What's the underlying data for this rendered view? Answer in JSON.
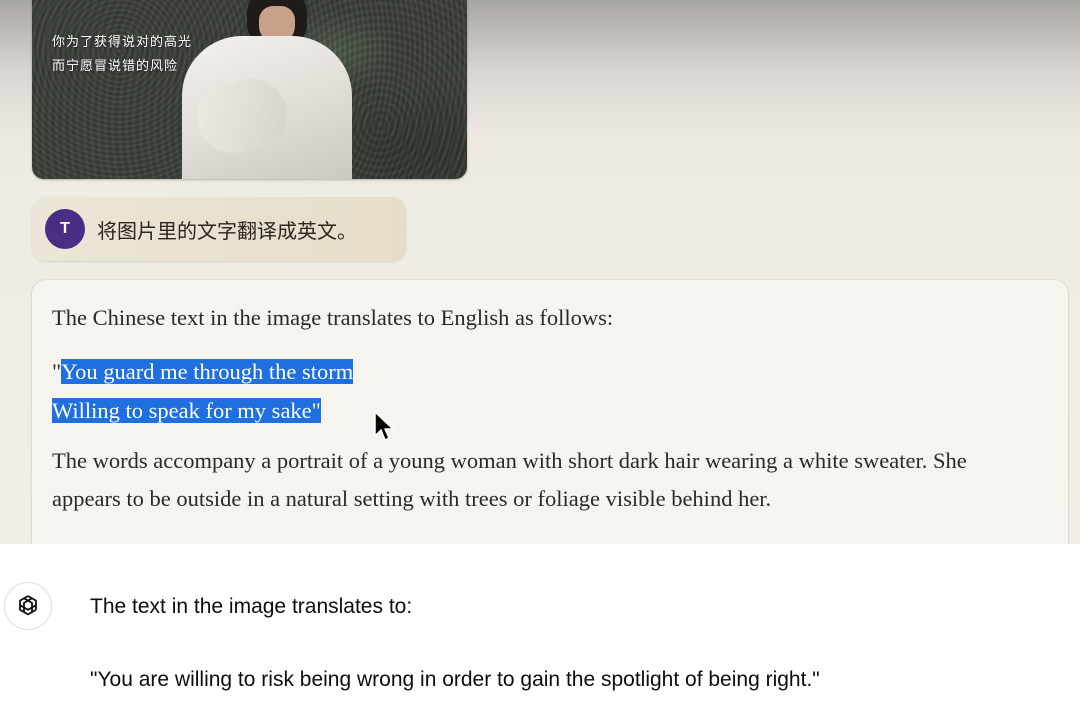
{
  "top_panel": {
    "image": {
      "caption_lines": [
        "你为了获得说对的高光",
        "而宁愿冒说错的风险"
      ]
    },
    "user_message": {
      "avatar_letter": "T",
      "text": "将图片里的文字翻译成英文。"
    },
    "assistant_message": {
      "intro": "The Chinese text in the image translates to English as follows:",
      "quote_open": "\"",
      "quote_line1": "You guard me through the storm",
      "quote_line2": "Willing to speak for my sake\"",
      "description": "The words accompany a portrait of a young woman with short dark hair wearing a white sweater. She appears to be outside in a natural setting with trees or foliage visible behind her."
    },
    "colors": {
      "selection": "#1f6fe0",
      "avatar": "#4a2e86"
    }
  },
  "bottom_panel": {
    "logo_icon": "chatgpt-logo-icon",
    "line1": "The text in the image translates to:",
    "line2": "\"You are willing to risk being wrong in order to gain the spotlight of being right.\""
  }
}
